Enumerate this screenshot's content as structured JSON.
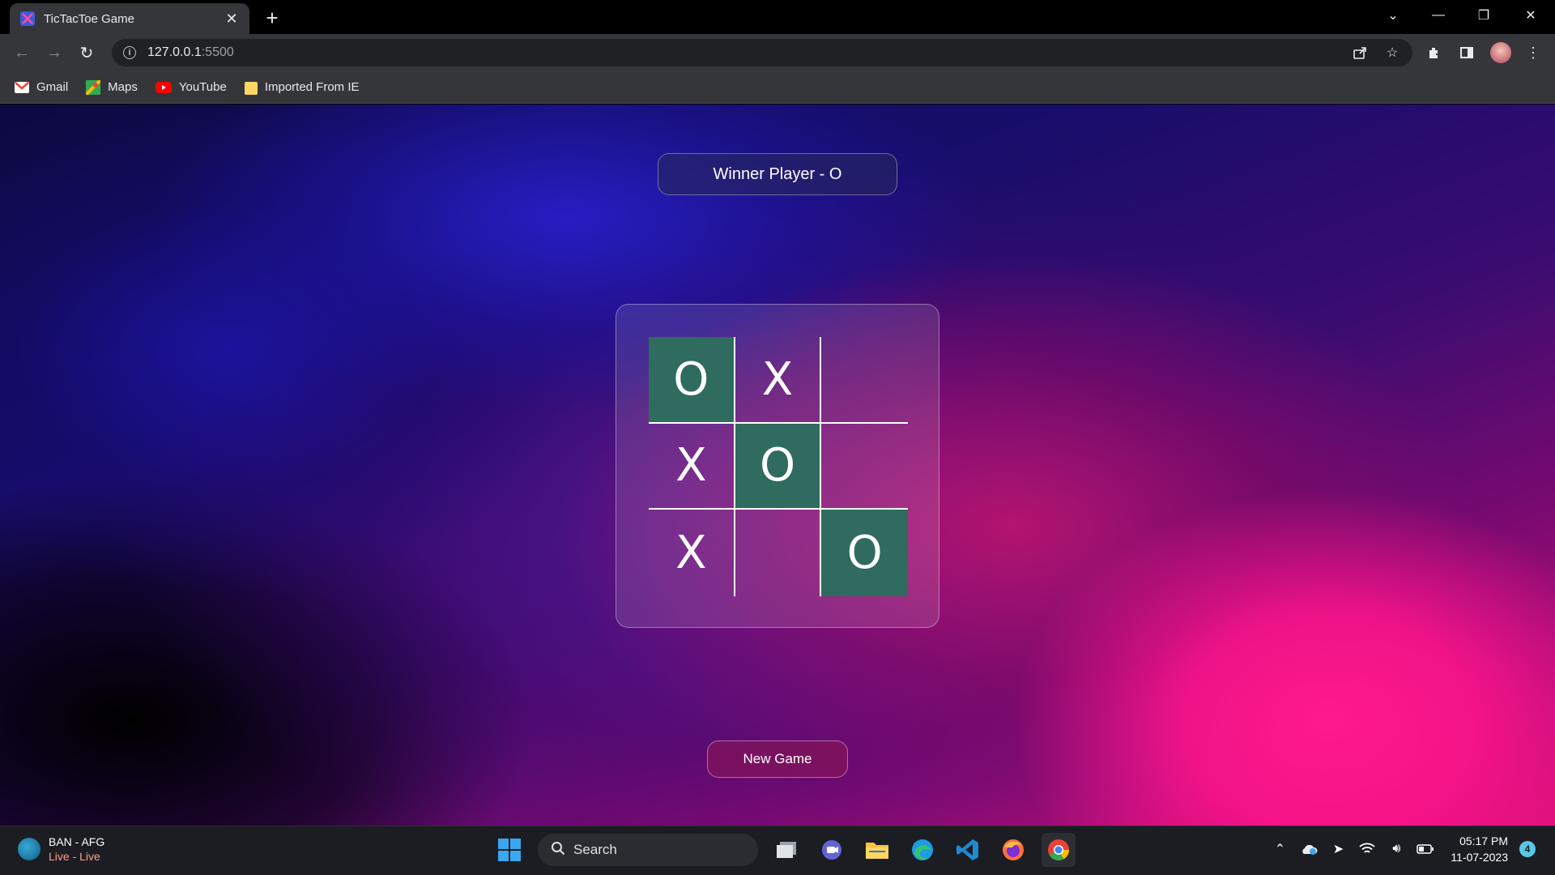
{
  "browser": {
    "tab_title": "TicTacToe Game",
    "url_host": "127.0.0.1",
    "url_port": ":5500",
    "bookmarks": [
      {
        "label": "Gmail",
        "icon": "gmail-icon"
      },
      {
        "label": "Maps",
        "icon": "maps-icon"
      },
      {
        "label": "YouTube",
        "icon": "youtube-icon"
      },
      {
        "label": "Imported From IE",
        "icon": "folder-icon"
      }
    ]
  },
  "game": {
    "status": "Winner Player - O",
    "board": [
      "O",
      "X",
      "",
      "X",
      "O",
      "",
      "X",
      "",
      "O"
    ],
    "winning_cells": [
      0,
      4,
      8
    ],
    "win_color": "#2f6b5e",
    "new_game_label": "New Game"
  },
  "taskbar": {
    "weather_title": "BAN - AFG",
    "weather_sub": "Live - Live",
    "search_label": "Search",
    "time": "05:17 PM",
    "date": "11-07-2023",
    "notification_count": "4"
  }
}
